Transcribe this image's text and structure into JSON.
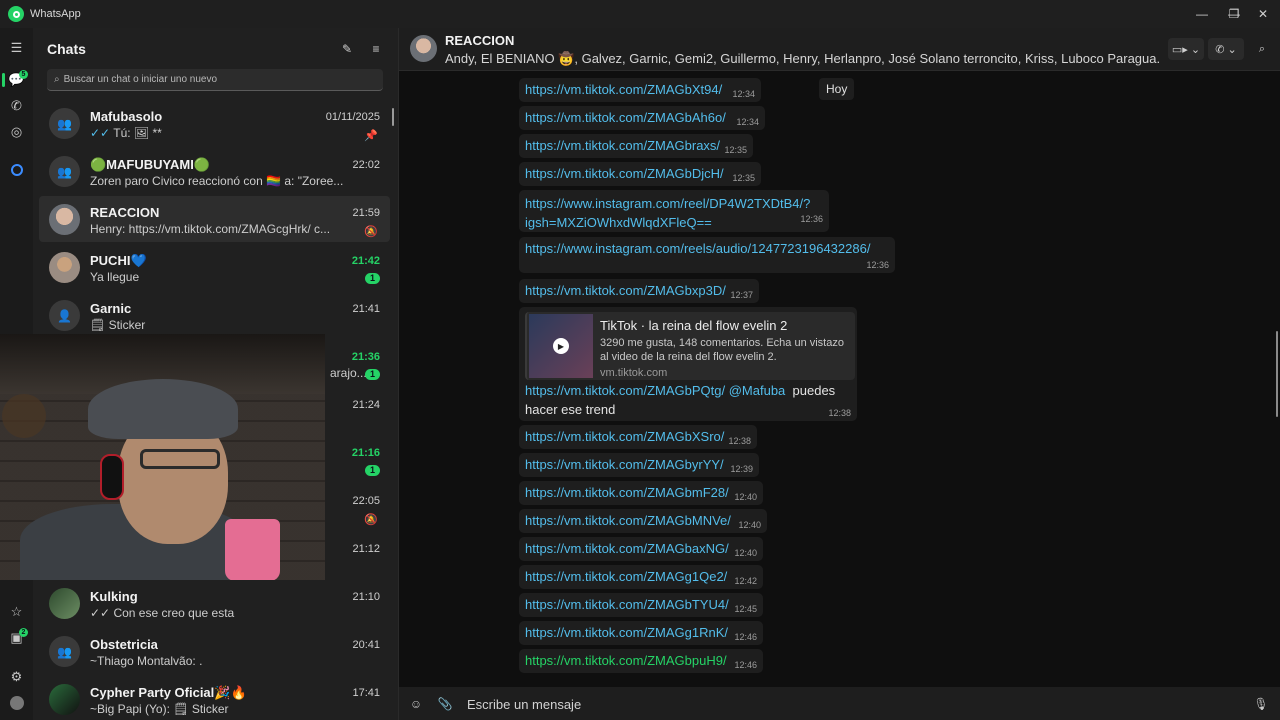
{
  "window": {
    "title": "WhatsApp",
    "controls": {
      "minimize": "—",
      "restore": "❐",
      "close": "✕"
    }
  },
  "rail": {
    "chats_badge": "5",
    "status_badge": "2"
  },
  "sidebar": {
    "title": "Chats",
    "search_placeholder": "Buscar un chat o iniciar uno nuevo"
  },
  "chats": [
    {
      "name": "Mafubasolo",
      "time": "01/11/2025",
      "tick": "✓✓",
      "preview": "Tú: 🖼 **"
    },
    {
      "name": "🟢MAFUBUYAMI🟢",
      "time": "22:02",
      "preview": "Zoren paro Civico reaccionó con 🏳️‍🌈 a: \"Zoree..."
    },
    {
      "name": "REACCION",
      "time": "21:59",
      "preview": "Henry: https://vm.tiktok.com/ZMAGcgHrk/ c..."
    },
    {
      "name": "PUCHI💙",
      "time": "21:42",
      "preview": "Ya llegue",
      "unread": "1"
    },
    {
      "name": "Garnic",
      "time": "21:41",
      "preview": "🗒 Sticker"
    },
    {
      "name": "",
      "time": "21:36",
      "preview": "arajo...",
      "unread": "1"
    },
    {
      "name": "",
      "time": "21:24",
      "preview": ""
    },
    {
      "name": "",
      "time": "21:16",
      "preview": "",
      "unread": "1"
    },
    {
      "name": "",
      "time": "22:05",
      "preview": ""
    },
    {
      "name": "",
      "time": "21:12",
      "preview": ""
    },
    {
      "name": "Kulking",
      "time": "21:10",
      "tick": "✓✓",
      "preview": "Con ese creo que esta"
    },
    {
      "name": "Obstetricia",
      "time": "20:41",
      "preview": "~Thiago Montalvão: ."
    },
    {
      "name": "Cypher Party Oficial🎉🔥",
      "time": "17:41",
      "preview": "~Big Papi (Yo): 🗒 Sticker"
    }
  ],
  "conversation": {
    "title": "REACCION",
    "members": "Andy, El BENIANO 🤠, Galvez, Garnic, Gemi2, Guillermo, Henry, Herlanpro, José Solano terroncito, Kriss, Luboco Paragua...",
    "day_chip": "Hoy",
    "messages": [
      {
        "text": "https://vm.tiktok.com/ZMAGbXt94/",
        "time": "12:34"
      },
      {
        "text": "https://vm.tiktok.com/ZMAGbAh6o/",
        "time": "12:34"
      },
      {
        "text": "https://vm.tiktok.com/ZMAGbraxs/",
        "time": "12:35"
      },
      {
        "text": "https://vm.tiktok.com/ZMAGbDjcH/",
        "time": "12:35"
      },
      {
        "text_line1": "https://www.instagram.com/reel/DP4W2TXDtB4/?",
        "text_line2": "igsh=MXZiOWhxdWlqdXFleQ==",
        "time": "12:36"
      },
      {
        "text": "https://www.instagram.com/reels/audio/1247723196432286/",
        "time": "12:36"
      },
      {
        "text": "https://vm.tiktok.com/ZMAGbxp3D/",
        "time": "12:37"
      },
      {
        "link": "https://vm.tiktok.com/ZMAGbPQtg/",
        "mention": "@Mafuba",
        "rest1": "puedes",
        "rest2": "hacer ese trend",
        "time": "12:38"
      },
      {
        "text": "https://vm.tiktok.com/ZMAGbXSro/",
        "time": "12:38"
      },
      {
        "text": "https://vm.tiktok.com/ZMAGbyrYY/",
        "time": "12:39"
      },
      {
        "text": "https://vm.tiktok.com/ZMAGbmF28/",
        "time": "12:40"
      },
      {
        "text": "https://vm.tiktok.com/ZMAGbMNVe/",
        "time": "12:40"
      },
      {
        "text": "https://vm.tiktok.com/ZMAGbaxNG/",
        "time": "12:40"
      },
      {
        "text": "https://vm.tiktok.com/ZMAGg1Qe2/",
        "time": "12:42"
      },
      {
        "text": "https://vm.tiktok.com/ZMAGbTYU4/",
        "time": "12:45"
      },
      {
        "text": "https://vm.tiktok.com/ZMAGg1RnK/",
        "time": "12:46"
      },
      {
        "text": "https://vm.tiktok.com/ZMAGbpuH9/",
        "time": "12:46"
      }
    ],
    "preview": {
      "title": "TikTok · la reina del flow evelin 2",
      "description": "3290 me gusta, 148 comentarios. Echa un vistazo al video de la reina del flow evelin 2.",
      "domain": "vm.tiktok.com"
    },
    "composer_placeholder": "Escribe un mensaje"
  }
}
